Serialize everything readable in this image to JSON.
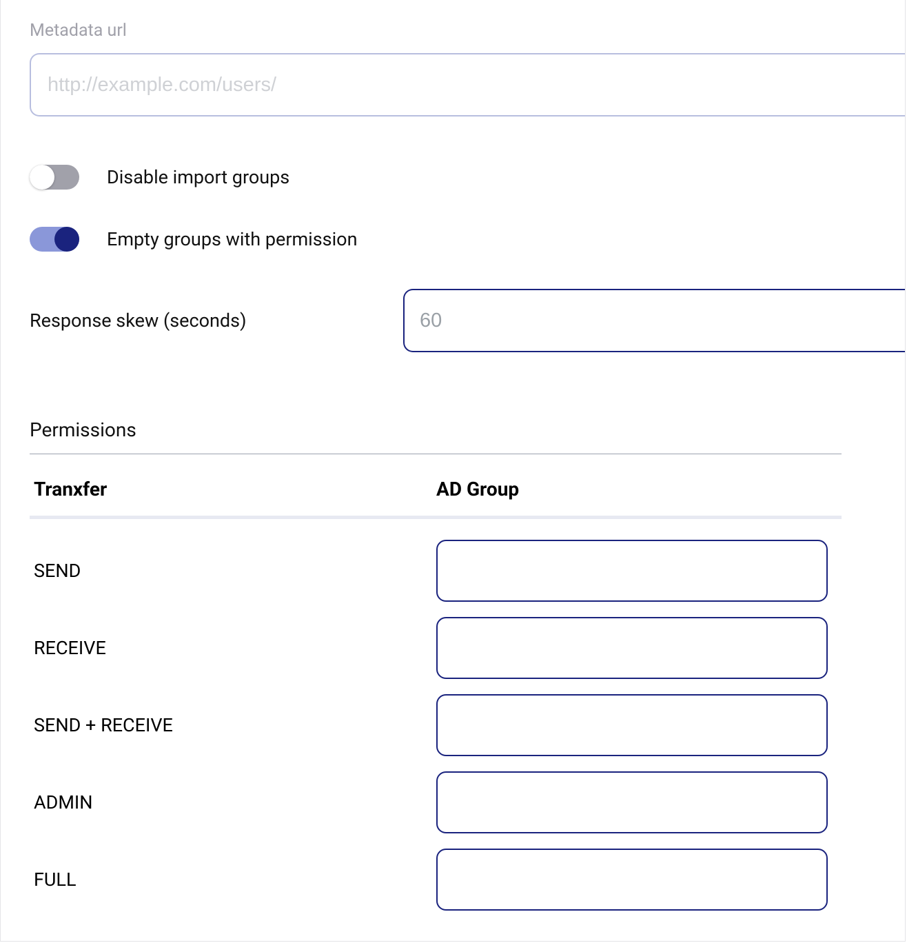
{
  "metadata": {
    "label": "Metadata url",
    "placeholder": "http://example.com/users/",
    "value": ""
  },
  "toggles": {
    "disable_import_groups": {
      "label": "Disable import groups",
      "on": false
    },
    "empty_groups_permission": {
      "label": "Empty groups with permission",
      "on": true
    }
  },
  "response_skew": {
    "label": "Response skew (seconds)",
    "placeholder": "60",
    "value": ""
  },
  "permissions": {
    "title": "Permissions",
    "headers": {
      "col1": "Tranxfer",
      "col2": "AD Group"
    },
    "rows": [
      {
        "name": "SEND",
        "value": ""
      },
      {
        "name": "RECEIVE",
        "value": ""
      },
      {
        "name": "SEND + RECEIVE",
        "value": ""
      },
      {
        "name": "ADMIN",
        "value": ""
      },
      {
        "name": "FULL",
        "value": ""
      }
    ]
  }
}
